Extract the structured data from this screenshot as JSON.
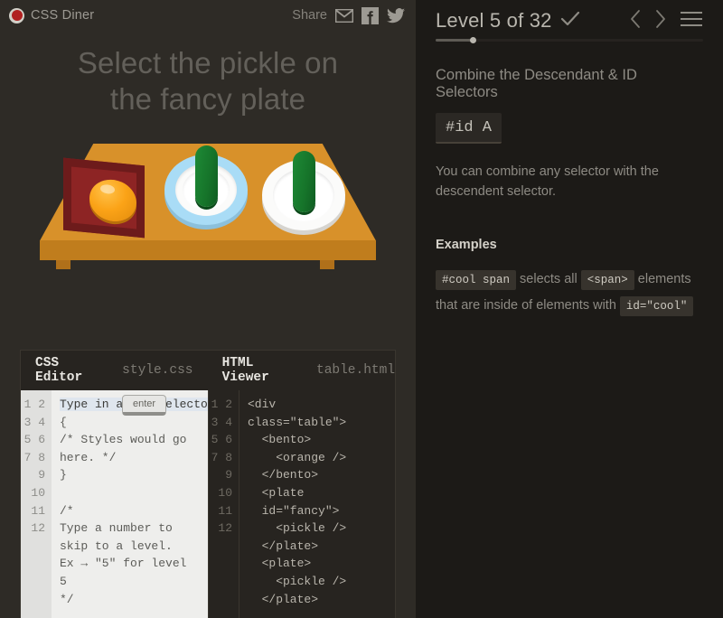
{
  "header": {
    "logo_label": "CSS Diner",
    "logo_icon": "tomato-icon",
    "share_label": "Share",
    "share_icons": [
      "email-icon",
      "facebook-icon",
      "twitter-icon"
    ]
  },
  "puzzle": {
    "title_line1": "Select the pickle on",
    "title_line2": "the fancy plate"
  },
  "scene": {
    "items": [
      {
        "type": "bento",
        "contains": "orange"
      },
      {
        "type": "plate",
        "id": "fancy",
        "contains": "pickle"
      },
      {
        "type": "plate",
        "contains": "pickle"
      }
    ]
  },
  "editor": {
    "css_tab_label": "CSS Editor",
    "css_file_name": "style.css",
    "html_tab_label": "HTML Viewer",
    "html_file_name": "table.html",
    "enter_button_label": "enter",
    "css_placeholder": "Type in a CSS selector",
    "css_lines": [
      "Type in a CSS selector",
      "{",
      "/* Styles would go",
      "here. */",
      "}",
      "",
      "/*",
      "Type a number to",
      "skip to a level.",
      "Ex → \"5\" for level",
      "5",
      "*/"
    ],
    "css_line_numbers": [
      "1",
      "2",
      "3",
      "4",
      "5",
      "6",
      "7",
      "8",
      "9",
      "10",
      "11",
      "12"
    ],
    "html_lines": [
      "<div",
      "class=\"table\">",
      "  <bento>",
      "    <orange />",
      "  </bento>",
      "  <plate",
      "  id=\"fancy\">",
      "    <pickle />",
      "  </plate>",
      "  <plate>",
      "    <pickle />",
      "  </plate>"
    ],
    "html_line_numbers": [
      "1",
      "2",
      "3",
      "4",
      "5",
      "6",
      "7",
      "8",
      "9",
      "10",
      "11",
      "12"
    ]
  },
  "lesson": {
    "level_label": "Level 5 of 32",
    "level_number": 5,
    "level_total": 32,
    "completed_icon": "check-icon",
    "prev_icon": "chevron-left-icon",
    "next_icon": "chevron-right-icon",
    "menu_icon": "hamburger-menu-icon",
    "progress_percent": 14,
    "heading": "Combine the Descendant & ID Selectors",
    "selector_chip": "#id A",
    "description": "You can combine any selector with the descendent selector.",
    "examples_heading": "Examples",
    "example": {
      "code1": "#cool span",
      "text1": "selects all",
      "code2": "<span>",
      "text2": "elements that are inside of elements with",
      "code3": "id=\"cool\""
    }
  },
  "colors": {
    "left_panel_bg": "#2e2b26",
    "right_panel_bg": "#1c1a17",
    "table_top": "#d8912a",
    "table_edge": "#c07d1d",
    "bento_inner": "#8d2424",
    "bento_border": "#6d1b1b",
    "orange": "#fba317",
    "fancy_plate_rim": "#a9dcf6",
    "plate_white": "#ffffff",
    "pickle_green": "#16742a",
    "logo_red": "#b02020",
    "css_editor_bg": "#eeeeec",
    "html_viewer_bg": "#272420"
  }
}
